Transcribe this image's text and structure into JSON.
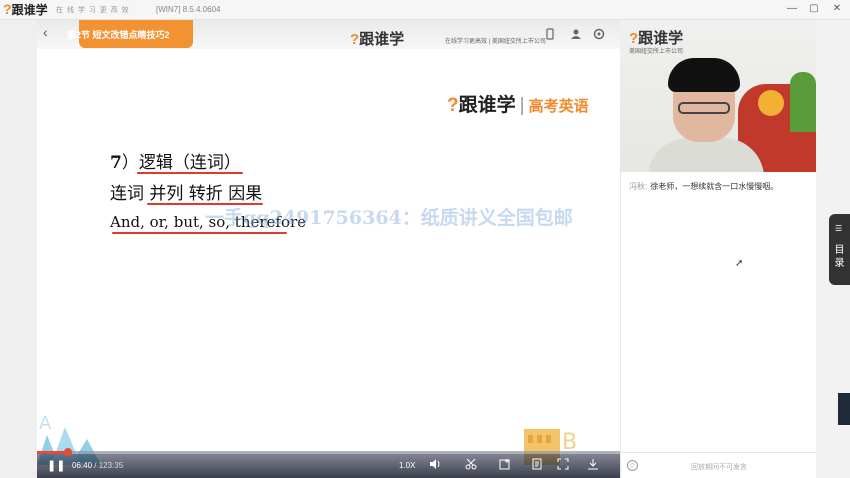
{
  "window": {
    "logo": "跟谁学",
    "slogan": "在 线 学 习 更 高 效",
    "version": "[WIN7] 8.5.4.0604",
    "buttons": {
      "minimize": "—",
      "maximize": "▢",
      "close": "✕"
    }
  },
  "player": {
    "back": "‹",
    "tag": "全部课程",
    "lesson_title": "第2节 短文改错点睛技巧2",
    "top_logo": "跟谁学",
    "top_slogan": "在线学习更高效 | 美国纽交所上市公司",
    "top_icons": [
      "share-icon",
      "person-icon",
      "settings-icon"
    ],
    "brand": {
      "name": "跟谁学",
      "sep": "|",
      "sub": "高考英语"
    },
    "slide": {
      "line1_num": "7",
      "line1": "）逻辑（连词）",
      "line2": "连词 并列 转折 因果",
      "line3": "And, or, but, so, therefore",
      "watermark": "一手qq2491756364：纸质讲义全国包邮"
    },
    "controls": {
      "play_icon": "❚❚",
      "current_time": "06:40",
      "duration": "/ 123:35",
      "speed": "1.0X",
      "progress_fraction": 0.054
    }
  },
  "video": {
    "logo": "跟谁学",
    "sub": "美国纽交所上市公司"
  },
  "chat": {
    "messages": [
      {
        "user": "冯秋:",
        "text": "徐老师，一想续就含一口水慢慢咽。"
      }
    ],
    "placeholder": "回放期间不可发言"
  },
  "toc": {
    "label": "目录"
  }
}
